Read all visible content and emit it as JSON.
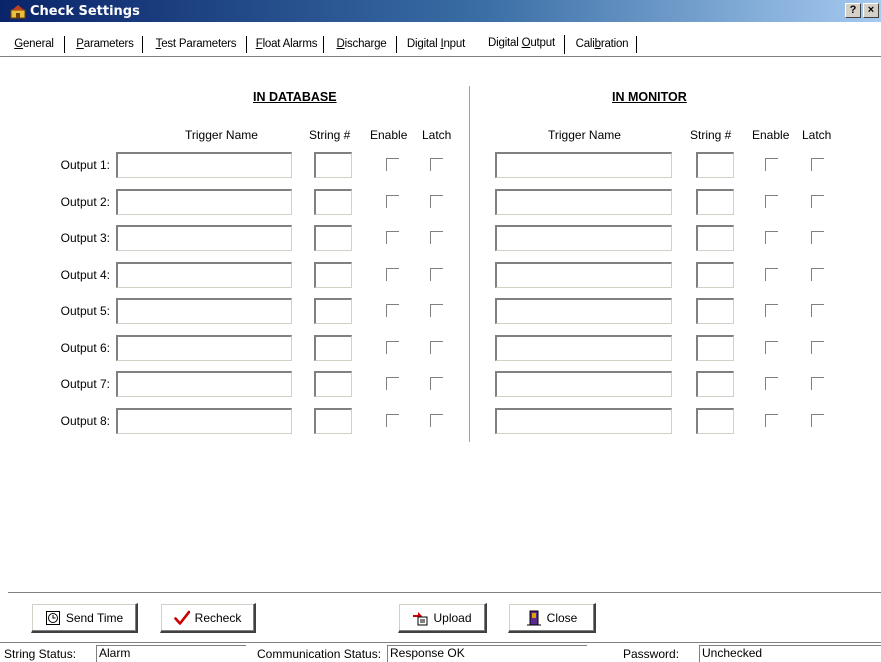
{
  "window": {
    "title": "Check Settings",
    "help_label": "?",
    "close_label": "×"
  },
  "tabs": [
    {
      "label": "General",
      "underline": "G"
    },
    {
      "label": "Parameters",
      "underline": "P"
    },
    {
      "label": "Test Parameters",
      "underline": "T"
    },
    {
      "label": "Float Alarms",
      "underline": "F"
    },
    {
      "label": "Discharge",
      "underline": "D"
    },
    {
      "label": "Digital Input",
      "underline": "I"
    },
    {
      "label": "Digital Output",
      "underline": "O",
      "active": true
    },
    {
      "label": "Calibration",
      "underline": "b"
    }
  ],
  "database": {
    "heading": "IN DATABASE",
    "col_trigger": "Trigger Name",
    "col_string": "String #",
    "col_enable": "Enable",
    "col_latch": "Latch"
  },
  "monitor": {
    "heading": "IN MONITOR",
    "col_trigger": "Trigger Name",
    "col_string": "String #",
    "col_enable": "Enable",
    "col_latch": "Latch"
  },
  "outputs": [
    {
      "label": "Output 1:",
      "db_trigger": "",
      "db_string": "",
      "mon_trigger": "",
      "mon_string": ""
    },
    {
      "label": "Output 2:",
      "db_trigger": "",
      "db_string": "",
      "mon_trigger": "",
      "mon_string": ""
    },
    {
      "label": "Output 3:",
      "db_trigger": "",
      "db_string": "",
      "mon_trigger": "",
      "mon_string": ""
    },
    {
      "label": "Output 4:",
      "db_trigger": "",
      "db_string": "",
      "mon_trigger": "",
      "mon_string": ""
    },
    {
      "label": "Output 5:",
      "db_trigger": "",
      "db_string": "",
      "mon_trigger": "",
      "mon_string": ""
    },
    {
      "label": "Output 6:",
      "db_trigger": "",
      "db_string": "",
      "mon_trigger": "",
      "mon_string": ""
    },
    {
      "label": "Output 7:",
      "db_trigger": "",
      "db_string": "",
      "mon_trigger": "",
      "mon_string": ""
    },
    {
      "label": "Output 8:",
      "db_trigger": "",
      "db_string": "",
      "mon_trigger": "",
      "mon_string": ""
    }
  ],
  "buttons": {
    "send_time": {
      "label": "Send Time",
      "icon": "clock-icon"
    },
    "recheck": {
      "label": "Recheck",
      "icon": "checkmark-icon"
    },
    "upload": {
      "label": "Upload",
      "icon": "upload-icon"
    },
    "close": {
      "label": "Close",
      "icon": "door-icon"
    }
  },
  "status": {
    "string_label": "String Status:",
    "string_value": "Alarm",
    "comm_label": "Communication Status:",
    "comm_value": "Response OK",
    "password_label": "Password:",
    "password_value": "Unchecked"
  },
  "colors": {
    "titlebar_start": "#0a246a",
    "titlebar_end": "#a6caf0",
    "check_red": "#cc0000"
  }
}
